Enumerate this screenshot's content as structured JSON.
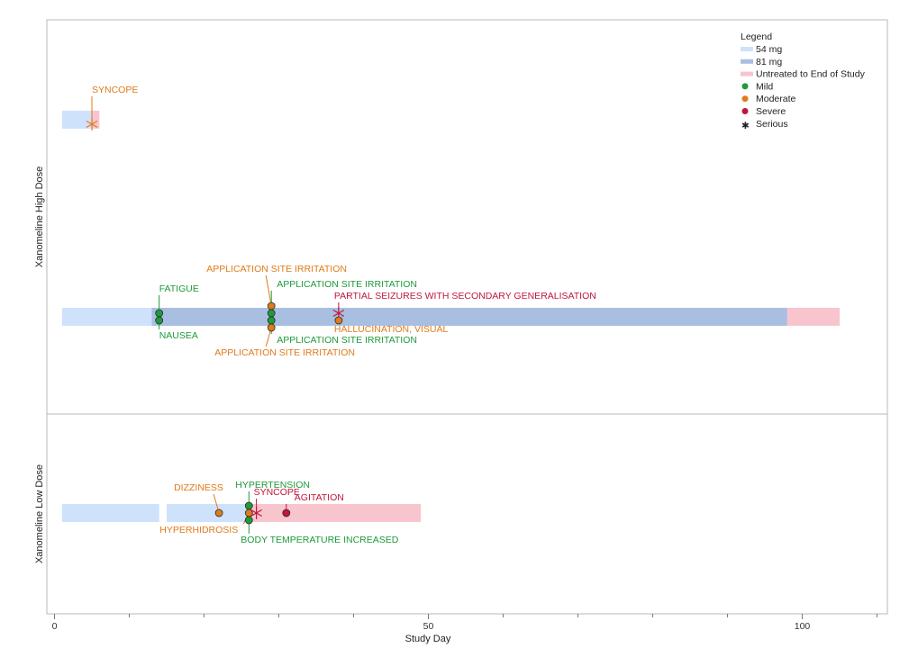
{
  "chart_data": {
    "type": "timeline",
    "xlabel": "Study Day",
    "x_ticks": [
      0,
      50,
      100
    ],
    "xlim": [
      -1,
      111
    ],
    "legend": {
      "title": "Legend",
      "placement": "top-right",
      "items": [
        {
          "label": "54 mg",
          "kind": "band",
          "color": "#cfe2fb"
        },
        {
          "label": "81 mg",
          "kind": "band",
          "color": "#a9bfe2"
        },
        {
          "label": "Untreated to End of Study",
          "kind": "band",
          "color": "#f8c5cf"
        },
        {
          "label": "Mild",
          "kind": "dot",
          "color": "#1e9a3a"
        },
        {
          "label": "Moderate",
          "kind": "dot",
          "color": "#e07a1b"
        },
        {
          "label": "Severe",
          "kind": "dot",
          "color": "#c0173a"
        },
        {
          "label": "Serious",
          "kind": "star",
          "color": "#222222"
        }
      ]
    },
    "colors": {
      "mild": "#1e9a3a",
      "moderate": "#e07a1b",
      "severe": "#c0173a"
    },
    "panels": [
      {
        "name": "Xanomeline High Dose",
        "subjects": [
          {
            "segments": [
              {
                "start": 1,
                "end": 5,
                "dose": "54 mg"
              },
              {
                "start": 5,
                "end": 6,
                "dose": "Untreated to End of Study"
              }
            ],
            "events": [
              {
                "term": "SYNCOPE",
                "day": 5,
                "severity": "moderate",
                "serious": true,
                "label_dx": 0,
                "label_dy": -30,
                "lead": 5
              }
            ]
          },
          {
            "segments": [
              {
                "start": 1,
                "end": 13,
                "dose": "54 mg"
              },
              {
                "start": 13,
                "end": 98,
                "dose": "81 mg"
              },
              {
                "start": 98,
                "end": 105,
                "dose": "Untreated to End of Study"
              }
            ],
            "events": [
              {
                "term": "FATIGUE",
                "day": 14,
                "severity": "mild",
                "serious": false,
                "label_dx": 0,
                "label_dy": -28,
                "lead": -4
              },
              {
                "term": "NAUSEA",
                "day": 14,
                "severity": "mild",
                "serious": false,
                "label_dx": 0,
                "label_dy": 24,
                "lead": 4
              },
              {
                "term": "APPLICATION SITE IRRITATION",
                "day": 29,
                "severity": "moderate",
                "serious": false,
                "label_dx": -72,
                "label_dy": -50,
                "lead": -12
              },
              {
                "term": "APPLICATION SITE IRRITATION",
                "day": 29,
                "severity": "mild",
                "serious": false,
                "label_dx": 6,
                "label_dy": -33,
                "lead": -4
              },
              {
                "term": "APPLICATION SITE IRRITATION",
                "day": 29,
                "severity": "mild",
                "serious": false,
                "label_dx": 6,
                "label_dy": 29,
                "lead": 4
              },
              {
                "term": "APPLICATION SITE IRRITATION",
                "day": 29,
                "severity": "moderate",
                "serious": false,
                "label_dx": -63,
                "label_dy": 43,
                "lead": 12
              },
              {
                "term": "PARTIAL SEIZURES WITH SECONDARY GENERALISATION",
                "day": 38,
                "severity": "severe",
                "serious": true,
                "label_dx": -5,
                "label_dy": -20,
                "lead": -4
              },
              {
                "term": "HALLUCINATION, VISUAL",
                "day": 38,
                "severity": "moderate",
                "serious": false,
                "label_dx": -5,
                "label_dy": 17,
                "lead": 4
              }
            ]
          }
        ]
      },
      {
        "name": "Xanomeline Low Dose",
        "subjects": [
          {
            "segments": [
              {
                "start": 1,
                "end": 14,
                "dose": "54 mg"
              },
              {
                "start": 15,
                "end": 26,
                "dose": "54 mg"
              },
              {
                "start": 26,
                "end": 49,
                "dose": "Untreated to End of Study"
              }
            ],
            "events": [
              {
                "term": "DIZZINESS",
                "day": 22,
                "severity": "moderate",
                "serious": false,
                "label_dx": -50,
                "label_dy": -25,
                "lead": 0
              },
              {
                "term": "HYPERTENSION",
                "day": 26,
                "severity": "mild",
                "serious": false,
                "label_dx": -15,
                "label_dy": -28,
                "lead": -8
              },
              {
                "term": "HYPERHIDROSIS",
                "day": 26,
                "severity": "moderate",
                "serious": false,
                "label_dx": -99,
                "label_dy": 22,
                "lead": 0
              },
              {
                "term": "BODY TEMPERATURE INCREASED",
                "day": 26,
                "severity": "mild",
                "serious": false,
                "label_dx": -9,
                "label_dy": 33,
                "lead": 8
              },
              {
                "term": "SYNCOPE",
                "day": 27,
                "severity": "severe",
                "serious": true,
                "label_dx": -3,
                "label_dy": -20,
                "lead": 0
              },
              {
                "term": "AGITATION",
                "day": 31,
                "severity": "severe",
                "serious": false,
                "label_dx": 9,
                "label_dy": -14,
                "lead": 0
              }
            ]
          }
        ]
      }
    ]
  }
}
